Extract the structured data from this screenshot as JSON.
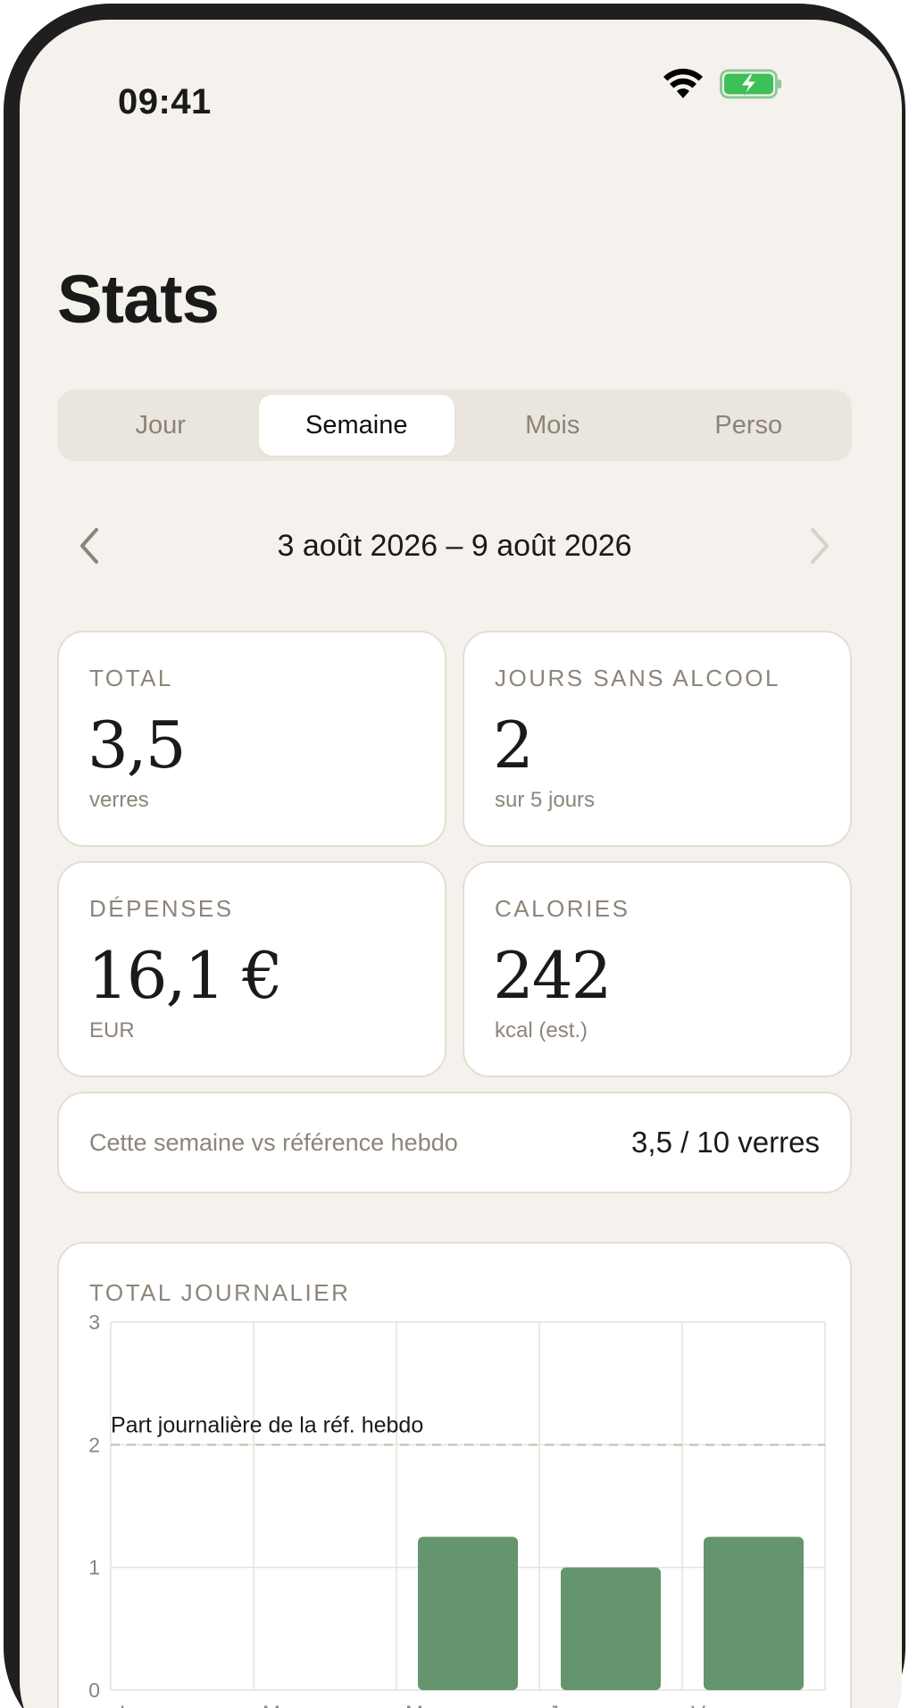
{
  "status_bar": {
    "time": "09:41"
  },
  "page": {
    "title": "Stats"
  },
  "tabs": [
    {
      "label": "Jour",
      "active": false
    },
    {
      "label": "Semaine",
      "active": true
    },
    {
      "label": "Mois",
      "active": false
    },
    {
      "label": "Perso",
      "active": false
    }
  ],
  "date_nav": {
    "range": "3 août 2026 – 9 août 2026",
    "prev_icon": "chevron-left-icon",
    "next_icon": "chevron-right-icon"
  },
  "stats": {
    "total": {
      "label": "TOTAL",
      "value": "3,5",
      "unit": "verres"
    },
    "alcohol_free_days": {
      "label": "JOURS SANS ALCOOL",
      "value": "2",
      "unit": "sur 5 jours"
    },
    "spending": {
      "label": "DÉPENSES",
      "value": "16,1 €",
      "unit": "EUR"
    },
    "calories": {
      "label": "CALORIES",
      "value": "242",
      "unit": "kcal (est.)"
    }
  },
  "reference": {
    "label": "Cette semaine vs référence hebdo",
    "value": "3,5 / 10 verres"
  },
  "colors": {
    "background": "#f5f2ed",
    "card": "#ffffff",
    "bar": "#65956f",
    "muted": "#8d8579",
    "reference_line": "#c9b7a3"
  },
  "chart_data": {
    "type": "bar",
    "title": "TOTAL JOURNALIER",
    "categories": [
      "L",
      "M",
      "M",
      "J",
      "V"
    ],
    "values": [
      0,
      0,
      1.25,
      1.0,
      1.25
    ],
    "ylim": [
      0,
      3
    ],
    "yticks": [
      "0",
      "1",
      "2",
      "3"
    ],
    "reference_line": {
      "value": 2,
      "label": "Part journalière de la réf. hebdo",
      "style": "dashed"
    },
    "grid": true
  }
}
